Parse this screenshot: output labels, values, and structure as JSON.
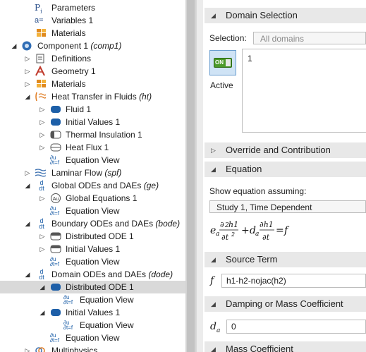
{
  "tree": {
    "items": [
      {
        "label": "Parameters",
        "tag": ""
      },
      {
        "label": "Variables 1",
        "tag": ""
      },
      {
        "label": "Materials",
        "tag": ""
      },
      {
        "label": "Component 1 ",
        "tag": "(comp1)"
      },
      {
        "label": "Definitions",
        "tag": ""
      },
      {
        "label": "Geometry 1",
        "tag": ""
      },
      {
        "label": "Materials",
        "tag": ""
      },
      {
        "label": "Heat Transfer in Fluids ",
        "tag": "(ht)"
      },
      {
        "label": "Fluid 1",
        "tag": ""
      },
      {
        "label": "Initial Values 1",
        "tag": ""
      },
      {
        "label": "Thermal Insulation 1",
        "tag": ""
      },
      {
        "label": "Heat Flux 1",
        "tag": ""
      },
      {
        "label": "Equation View",
        "tag": ""
      },
      {
        "label": "Laminar Flow ",
        "tag": "(spf)"
      },
      {
        "label": "Global ODEs and DAEs ",
        "tag": "(ge)"
      },
      {
        "label": "Global Equations 1",
        "tag": ""
      },
      {
        "label": "Equation View",
        "tag": ""
      },
      {
        "label": "Boundary ODEs and DAEs ",
        "tag": "(bode)"
      },
      {
        "label": "Distributed ODE 1",
        "tag": ""
      },
      {
        "label": "Initial Values 1",
        "tag": ""
      },
      {
        "label": "Equation View",
        "tag": ""
      },
      {
        "label": "Domain ODEs and DAEs ",
        "tag": "(dode)"
      },
      {
        "label": "Distributed ODE 1",
        "tag": ""
      },
      {
        "label": "Equation View",
        "tag": ""
      },
      {
        "label": "Initial Values 1",
        "tag": ""
      },
      {
        "label": "Equation View",
        "tag": ""
      },
      {
        "label": "Equation View",
        "tag": ""
      },
      {
        "label": "Multiphysics",
        "tag": ""
      }
    ]
  },
  "settings": {
    "domain_selection": {
      "title": "Domain Selection",
      "selection_label": "Selection:",
      "selection_value": "All domains",
      "list_item": "1",
      "active_switch": "ON",
      "active_label": "Active"
    },
    "override_title": "Override and Contribution",
    "equation": {
      "title": "Equation",
      "show_label": "Show equation assuming:",
      "study_value": "Study 1, Time Dependent"
    },
    "source_term": {
      "title": "Source Term",
      "symbol": "f",
      "value": "h1-h2-nojac(h2)"
    },
    "damping": {
      "title": "Damping or Mass Coefficient",
      "symbol": "d",
      "sub": "a",
      "value": "0"
    },
    "mass": {
      "title": "Mass Coefficient"
    }
  },
  "icons": {
    "parameters": "parameters-icon",
    "variables": "variables-icon",
    "materials": "materials-icon",
    "component": "component-icon",
    "physics": "physics-node-icon",
    "equation_view": "equation-view-icon",
    "ode": "ode-interface-icon"
  },
  "colors": {
    "selected_row": "#d9d9d9",
    "section_header": "#e8e8e8",
    "node_blue": "#1d5fa8",
    "switch_green": "#4c9a2a"
  }
}
